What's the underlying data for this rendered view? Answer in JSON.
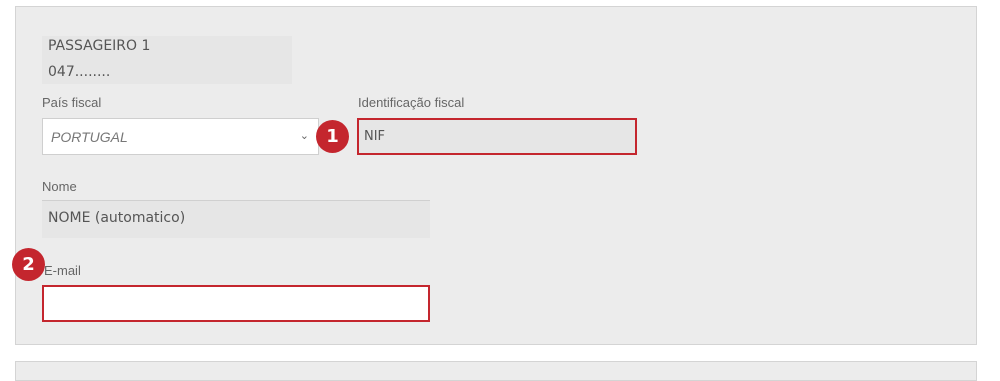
{
  "passenger": {
    "title": "PASSAGEIRO 1",
    "id": "047........"
  },
  "form": {
    "pais_fiscal": {
      "label": "País fiscal",
      "value": "PORTUGAL"
    },
    "identificacao_fiscal": {
      "label": "Identificação fiscal",
      "value": "NIF"
    },
    "nome": {
      "label": "Nome",
      "value": "NOME (automatico)"
    },
    "email": {
      "label": "E-mail",
      "value": ""
    }
  },
  "annotations": {
    "badge_1": "1",
    "badge_2": "2",
    "color": "#c4262e"
  }
}
